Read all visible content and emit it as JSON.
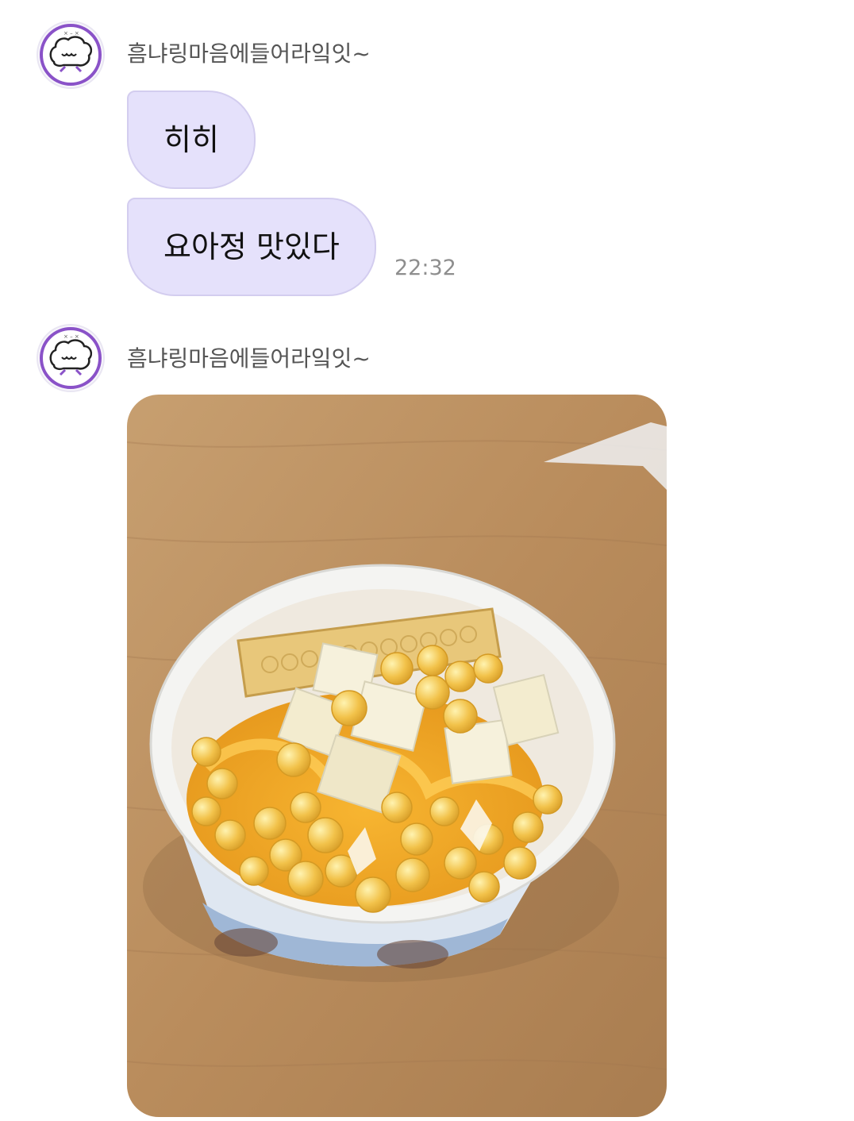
{
  "messages": [
    {
      "sender": "흠냐링마음에들어라잌잇~",
      "bubbles": [
        "히히",
        "요아정 맛있다"
      ],
      "time": "22:32"
    },
    {
      "sender": "흠냐링마음에들어라잌잇~",
      "photo": "dessert-cup-photo"
    }
  ],
  "colors": {
    "bubble": "#e5e1fb",
    "bubble_border": "#d3cdef",
    "avatar_accent": "#8a52c8"
  }
}
